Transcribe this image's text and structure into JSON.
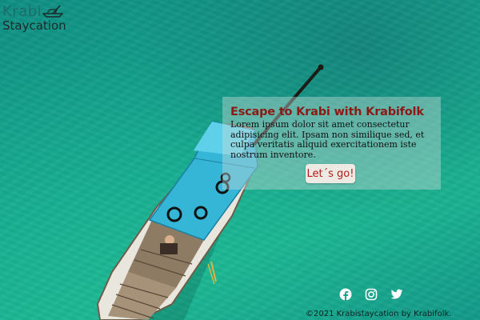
{
  "logo": {
    "line1": "Krabi",
    "line2": "Staycation"
  },
  "hero": {
    "title": "Escape to Krabi with Krabifolk",
    "text": "Lorem ipsum dolor sit amet consectetur adipisicing elit. Ipsam non similique sed, et culpa veritatis aliquid exercitationem iste nostrum inventore.",
    "button_label": "Let´s go!"
  },
  "social": {
    "icons": [
      "facebook-icon",
      "instagram-icon",
      "twitter-icon"
    ]
  },
  "footer": {
    "copyright": "©2021 Krabistaycation by Krabifolk."
  },
  "colors": {
    "title": "#8b1a14",
    "button_text": "#b11f19",
    "button_bg": "#ede9e3",
    "logo_krabi": "#1b6e6a",
    "water": "#14a890"
  }
}
